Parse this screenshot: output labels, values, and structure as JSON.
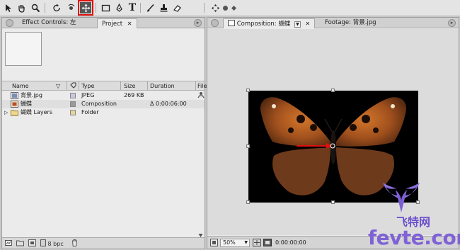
{
  "toolbar": {
    "tools": [
      {
        "name": "selection-tool"
      },
      {
        "name": "hand-tool"
      },
      {
        "name": "zoom-tool"
      },
      {
        "name": "rotation-tool"
      },
      {
        "name": "orbit-camera-tool"
      },
      {
        "name": "pan-behind-tool",
        "highlighted": true
      },
      {
        "name": "rectangle-mask-tool"
      },
      {
        "name": "pen-tool"
      },
      {
        "name": "type-tool",
        "glyph": "T"
      },
      {
        "name": "brush-tool"
      },
      {
        "name": "clone-stamp-tool"
      },
      {
        "name": "eraser-tool"
      }
    ],
    "highlight_color": "#e01010"
  },
  "left_panel": {
    "tabs": [
      {
        "label": "Effect Controls: 左"
      },
      {
        "label": "Project"
      }
    ],
    "columns": [
      "Name",
      "Type",
      "Size",
      "Duration",
      "File"
    ],
    "items": [
      {
        "name": "背景.jpg",
        "type": "JPEG",
        "size": "269 KB",
        "duration": "",
        "swatch": "#c8c8e0"
      },
      {
        "name": "蝴蝶",
        "type": "Composition",
        "size": "",
        "duration": "Δ 0:00:06:00",
        "swatch": "#9a9a9a"
      },
      {
        "name": "蝴蝶 Layers",
        "type": "Folder",
        "size": "",
        "duration": "",
        "swatch": "#e6d49a"
      }
    ],
    "status": {
      "bpc": "8 bpc"
    }
  },
  "right_panel": {
    "tabs": [
      {
        "label": "Composition: 蝴蝶"
      },
      {
        "label": "Footage: 背景.jpg"
      }
    ],
    "viewer": {
      "zoom": "50%",
      "timecode": "0:00:00:00"
    }
  },
  "watermark": {
    "site": "fevte.com",
    "cn": "飞特网"
  }
}
